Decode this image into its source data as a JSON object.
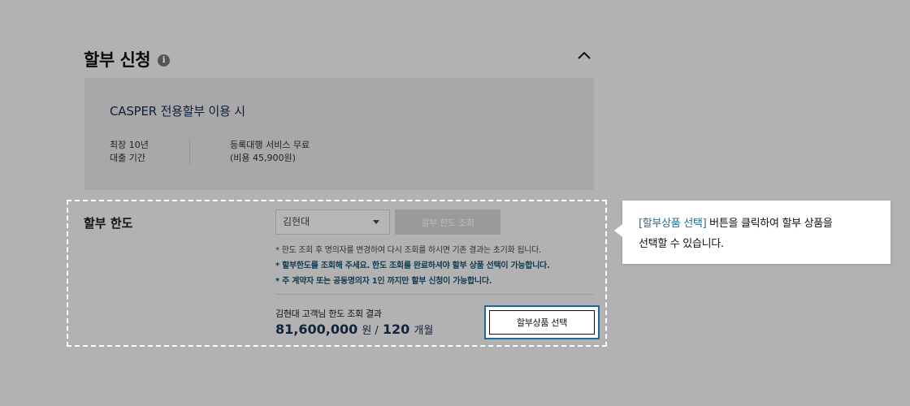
{
  "section": {
    "title": "할부 신청",
    "info_icon": "i"
  },
  "promo": {
    "title": "CASPER 전용할부 이용 시",
    "term_value": "최장 10년",
    "term_label": "대출 기간",
    "service_name": "등록대행 서비스 무료",
    "service_fee": "(비용 45,900원)"
  },
  "limit": {
    "label": "할부 한도",
    "select_value": "김현대",
    "query_button": "할부 한도 조회",
    "notes": [
      "* 한도 조회 후 명의자를 변경하여 다시 조회를 하시면 기존 결과는 초기화 됩니다.",
      "* 할부한도를 조회해 주세요. 한도 조회를 완료하셔야 할부 상품 선택이 가능합니다.",
      "* 주 계약자 또는 공동명의자 1인 까지만 할부 신청이 가능합니다."
    ],
    "result_caption": "김현대 고객님 한도 조회 결과",
    "result_amount": "81,600,000",
    "result_amount_unit": "원 /",
    "result_months": "120",
    "result_months_unit": "개월",
    "product_button": "할부상품 선택"
  },
  "tooltip": {
    "highlight": "[할부상품 선택]",
    "text_line1": " 버튼을 클릭하여 할부 상품을",
    "text_line2": "선택할 수 있습니다."
  },
  "colors": {
    "overlay": "#b2b2b2",
    "accent": "#1e6a94",
    "result_text": "#12243c"
  }
}
